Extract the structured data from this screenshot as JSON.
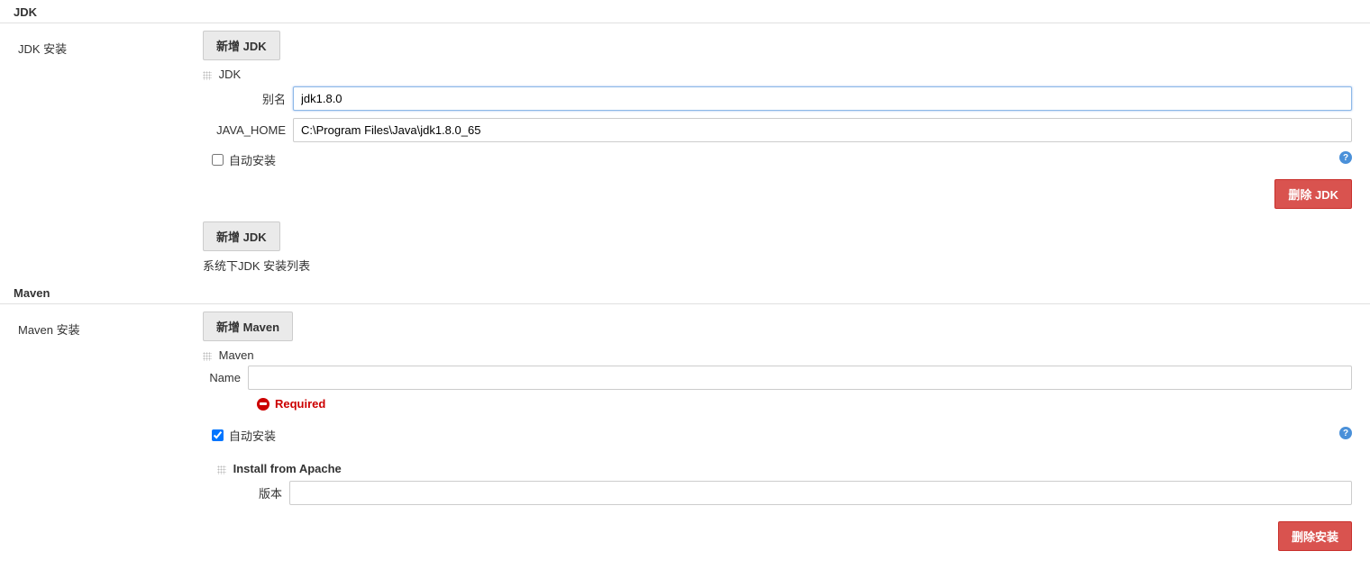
{
  "jdk": {
    "section_title": "JDK",
    "install_label": "JDK 安装",
    "add_button": "新增 JDK",
    "item_title": "JDK",
    "alias_label": "别名",
    "alias_value": "jdk1.8.0",
    "java_home_label": "JAVA_HOME",
    "java_home_value": "C:\\Program Files\\Java\\jdk1.8.0_65",
    "auto_install_label": "自动安装",
    "auto_install_checked": false,
    "delete_button": "删除 JDK",
    "add_button_2": "新增 JDK",
    "list_caption": "系统下JDK 安装列表"
  },
  "maven": {
    "section_title": "Maven",
    "install_label": "Maven 安装",
    "add_button": "新增 Maven",
    "item_title": "Maven",
    "name_label": "Name",
    "name_value": "",
    "error_text": "Required",
    "auto_install_label": "自动安装",
    "auto_install_checked": true,
    "install_from_title": "Install from Apache",
    "version_label": "版本",
    "version_value": "",
    "delete_button": "删除安装"
  }
}
